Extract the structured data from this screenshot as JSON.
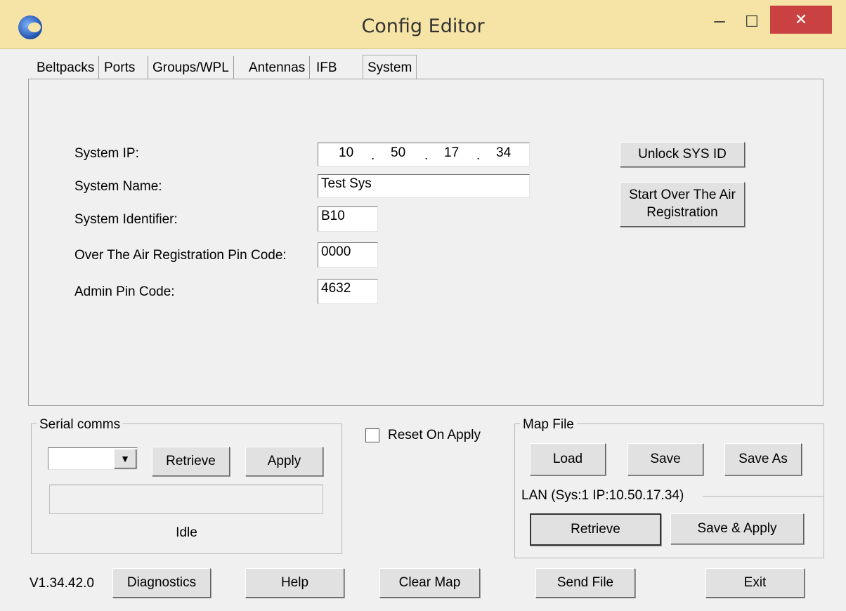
{
  "window": {
    "title": "Config Editor",
    "min": "–",
    "max": "☐",
    "close": "✕"
  },
  "tabs": [
    "Beltpacks",
    "Ports",
    "Groups/WPL",
    "Antennas",
    "IFB",
    "System"
  ],
  "system": {
    "ip_label": "System IP:",
    "ip": [
      "10",
      "50",
      "17",
      "34"
    ],
    "name_label": "System Name:",
    "name_value": "Test Sys",
    "identifier_label": "System Identifier:",
    "identifier_value": "B10",
    "ota_pin_label": "Over The Air Registration Pin Code:",
    "ota_pin_value": "0000",
    "admin_pin_label": "Admin Pin Code:",
    "admin_pin_value": "4632",
    "unlock_button": "Unlock SYS ID",
    "ota_button_line1": "Start Over The Air",
    "ota_button_line2": "Registration"
  },
  "serial": {
    "title": "Serial comms",
    "retrieve": "Retrieve",
    "apply": "Apply",
    "status": "Idle"
  },
  "reset_on_apply": "Reset On Apply",
  "map_file": {
    "title": "Map File",
    "load": "Load",
    "save": "Save",
    "save_as": "Save As",
    "lan_label": "LAN  (Sys:1 IP:10.50.17.34)",
    "retrieve": "Retrieve",
    "save_apply": "Save & Apply"
  },
  "footer": {
    "version": "V1.34.42.0",
    "diagnostics": "Diagnostics",
    "help": "Help",
    "clear_map": "Clear Map",
    "send_file": "Send File",
    "exit": "Exit"
  }
}
